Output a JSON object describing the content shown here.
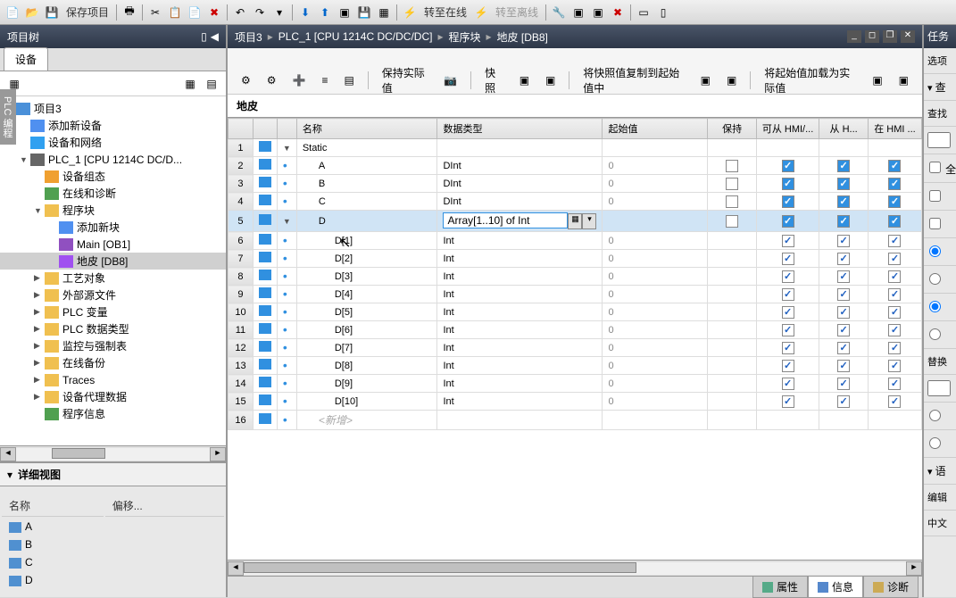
{
  "toolbar": {
    "save_label": "保存项目",
    "go_online": "转至在线",
    "go_offline": "转至离线"
  },
  "left": {
    "title": "项目树",
    "tab": "设备",
    "tree": [
      {
        "indent": 0,
        "arrow": "▼",
        "icon": "ico-prj",
        "label": "项目3"
      },
      {
        "indent": 1,
        "arrow": "",
        "icon": "ico-add",
        "label": "添加新设备"
      },
      {
        "indent": 1,
        "arrow": "",
        "icon": "ico-net",
        "label": "设备和网络"
      },
      {
        "indent": 1,
        "arrow": "▼",
        "icon": "ico-plc",
        "label": "PLC_1 [CPU 1214C DC/D..."
      },
      {
        "indent": 2,
        "arrow": "",
        "icon": "ico-dev",
        "label": "设备组态"
      },
      {
        "indent": 2,
        "arrow": "",
        "icon": "ico-blk",
        "label": "在线和诊断"
      },
      {
        "indent": 2,
        "arrow": "▼",
        "icon": "ico-folder",
        "label": "程序块"
      },
      {
        "indent": 3,
        "arrow": "",
        "icon": "ico-add",
        "label": "添加新块"
      },
      {
        "indent": 3,
        "arrow": "",
        "icon": "ico-main",
        "label": "Main [OB1]"
      },
      {
        "indent": 3,
        "arrow": "",
        "icon": "ico-db",
        "label": "地皮 [DB8]",
        "selected": true
      },
      {
        "indent": 2,
        "arrow": "▶",
        "icon": "ico-folder",
        "label": "工艺对象"
      },
      {
        "indent": 2,
        "arrow": "▶",
        "icon": "ico-folder",
        "label": "外部源文件"
      },
      {
        "indent": 2,
        "arrow": "▶",
        "icon": "ico-folder",
        "label": "PLC 变量"
      },
      {
        "indent": 2,
        "arrow": "▶",
        "icon": "ico-folder",
        "label": "PLC 数据类型"
      },
      {
        "indent": 2,
        "arrow": "▶",
        "icon": "ico-folder",
        "label": "监控与强制表"
      },
      {
        "indent": 2,
        "arrow": "▶",
        "icon": "ico-folder",
        "label": "在线备份"
      },
      {
        "indent": 2,
        "arrow": "▶",
        "icon": "ico-folder",
        "label": "Traces"
      },
      {
        "indent": 2,
        "arrow": "▶",
        "icon": "ico-folder",
        "label": "设备代理数据"
      },
      {
        "indent": 2,
        "arrow": "",
        "icon": "ico-blk",
        "label": "程序信息"
      }
    ],
    "detail_title": "详细视图",
    "detail_cols": {
      "name": "名称",
      "offset": "偏移..."
    },
    "detail_rows": [
      "A",
      "B",
      "C",
      "D"
    ]
  },
  "center": {
    "crumbs": [
      "项目3",
      "PLC_1 [CPU 1214C DC/DC/DC]",
      "程序块",
      "地皮 [DB8]"
    ],
    "ed_toolbar": {
      "keep_actual": "保持实际值",
      "snapshot": "快照",
      "copy_snap_to_start": "将快照值复制到起始值中",
      "load_start_as_actual": "将起始值加载为实际值"
    },
    "block_name": "地皮",
    "columns": {
      "name": "名称",
      "type": "数据类型",
      "start": "起始值",
      "retain": "保持",
      "hmi_acc": "可从 HMI/...",
      "hmi_w": "从 H...",
      "hmi_v": "在 HMI ..."
    },
    "rows": [
      {
        "n": 1,
        "arrow": "▼",
        "name": "Static",
        "type": "",
        "start": "",
        "retain": null,
        "c1": null,
        "c2": null,
        "c3": null,
        "lvl": 0
      },
      {
        "n": 2,
        "arrow": "",
        "dot": true,
        "name": "A",
        "type": "DInt",
        "start": "0",
        "retain": false,
        "c1": true,
        "c2": true,
        "c3": true,
        "filled": true,
        "lvl": 1
      },
      {
        "n": 3,
        "arrow": "",
        "dot": true,
        "name": "B",
        "type": "DInt",
        "start": "0",
        "retain": false,
        "c1": true,
        "c2": true,
        "c3": true,
        "filled": true,
        "lvl": 1
      },
      {
        "n": 4,
        "arrow": "",
        "dot": true,
        "name": "C",
        "type": "DInt",
        "start": "0",
        "retain": false,
        "c1": true,
        "c2": true,
        "c3": true,
        "filled": true,
        "lvl": 1
      },
      {
        "n": 5,
        "arrow": "▼",
        "dot": true,
        "name": "D",
        "type": "Array[1..10] of Int",
        "start": "",
        "retain": false,
        "c1": true,
        "c2": true,
        "c3": true,
        "filled": true,
        "lvl": 1,
        "sel": true,
        "editable": true
      },
      {
        "n": 6,
        "arrow": "",
        "dot": true,
        "name": "D[1]",
        "type": "Int",
        "start": "0",
        "retain": null,
        "c1": true,
        "c2": true,
        "c3": true,
        "lvl": 2
      },
      {
        "n": 7,
        "arrow": "",
        "dot": true,
        "name": "D[2]",
        "type": "Int",
        "start": "0",
        "retain": null,
        "c1": true,
        "c2": true,
        "c3": true,
        "lvl": 2
      },
      {
        "n": 8,
        "arrow": "",
        "dot": true,
        "name": "D[3]",
        "type": "Int",
        "start": "0",
        "retain": null,
        "c1": true,
        "c2": true,
        "c3": true,
        "lvl": 2
      },
      {
        "n": 9,
        "arrow": "",
        "dot": true,
        "name": "D[4]",
        "type": "Int",
        "start": "0",
        "retain": null,
        "c1": true,
        "c2": true,
        "c3": true,
        "lvl": 2
      },
      {
        "n": 10,
        "arrow": "",
        "dot": true,
        "name": "D[5]",
        "type": "Int",
        "start": "0",
        "retain": null,
        "c1": true,
        "c2": true,
        "c3": true,
        "lvl": 2
      },
      {
        "n": 11,
        "arrow": "",
        "dot": true,
        "name": "D[6]",
        "type": "Int",
        "start": "0",
        "retain": null,
        "c1": true,
        "c2": true,
        "c3": true,
        "lvl": 2
      },
      {
        "n": 12,
        "arrow": "",
        "dot": true,
        "name": "D[7]",
        "type": "Int",
        "start": "0",
        "retain": null,
        "c1": true,
        "c2": true,
        "c3": true,
        "lvl": 2
      },
      {
        "n": 13,
        "arrow": "",
        "dot": true,
        "name": "D[8]",
        "type": "Int",
        "start": "0",
        "retain": null,
        "c1": true,
        "c2": true,
        "c3": true,
        "lvl": 2
      },
      {
        "n": 14,
        "arrow": "",
        "dot": true,
        "name": "D[9]",
        "type": "Int",
        "start": "0",
        "retain": null,
        "c1": true,
        "c2": true,
        "c3": true,
        "lvl": 2
      },
      {
        "n": 15,
        "arrow": "",
        "dot": true,
        "name": "D[10]",
        "type": "Int",
        "start": "0",
        "retain": null,
        "c1": true,
        "c2": true,
        "c3": true,
        "lvl": 2
      },
      {
        "n": 16,
        "arrow": "",
        "dot": true,
        "name": "<新增>",
        "type": "",
        "start": "",
        "retain": null,
        "c1": null,
        "c2": null,
        "c3": null,
        "lvl": 1,
        "placeholder": true
      }
    ],
    "bottom_tabs": {
      "prop": "属性",
      "info": "信息",
      "diag": "诊断"
    }
  },
  "right": {
    "title": "任务",
    "option": "选项",
    "search": "查",
    "find": "查找",
    "all": "全",
    "rep": "替换",
    "lang": "语",
    "edit": "编辑",
    "c1": "中文"
  },
  "side_tab": "PLC 编程"
}
